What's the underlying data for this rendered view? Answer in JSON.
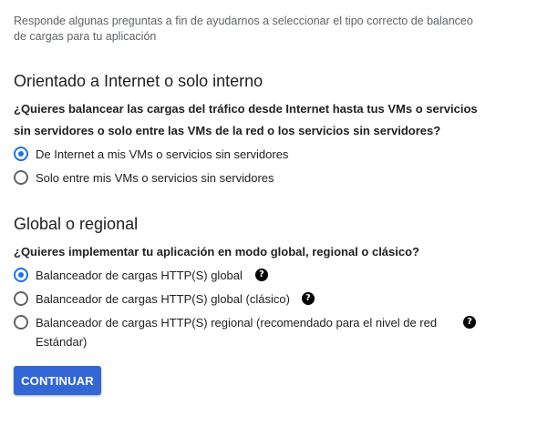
{
  "intro": "Responde algunas preguntas a fin de ayudarnos a seleccionar el tipo correcto de balanceo de cargas para tu aplicación",
  "section1": {
    "title": "Orientado a Internet o solo interno",
    "question": "¿Quieres balancear las cargas del tráfico desde Internet hasta tus VMs o servicios sin servidores o solo entre las VMs de la red o los servicios sin servidores?",
    "options": [
      {
        "label": "De Internet a mis VMs o servicios sin servidores",
        "checked": true
      },
      {
        "label": "Solo entre mis VMs o servicios sin servidores",
        "checked": false
      }
    ]
  },
  "section2": {
    "title": "Global o regional",
    "question": "¿Quieres implementar tu aplicación en modo global, regional o clásico?",
    "options": [
      {
        "label": "Balanceador de cargas HTTP(S) global",
        "checked": true,
        "help_icon": "help-circle-icon"
      },
      {
        "label": "Balanceador de cargas HTTP(S) global (clásico)",
        "checked": false,
        "help_icon": "help-circle-icon"
      },
      {
        "label": "Balanceador de cargas HTTP(S) regional (recomendado para el nivel de red Estándar)",
        "checked": false,
        "help_icon": "help-circle-icon"
      }
    ]
  },
  "continue_label": "Continuar",
  "help_glyph": "?",
  "colors": {
    "accent": "#1a73e8",
    "button": "#3367d6"
  }
}
